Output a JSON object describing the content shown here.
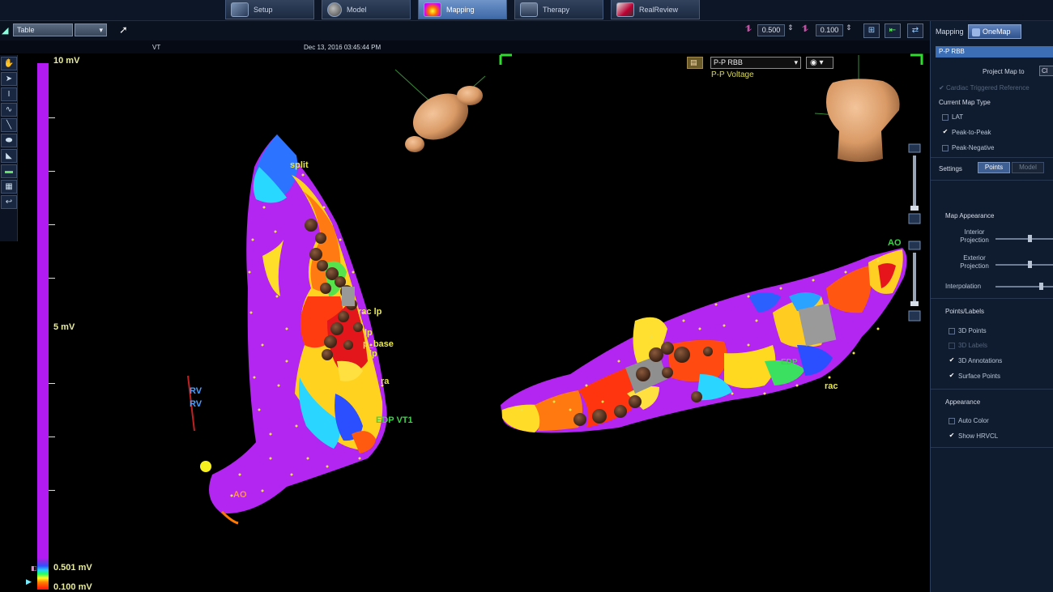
{
  "tabs": [
    {
      "label": "Setup",
      "icon": "setup-icon"
    },
    {
      "label": "Model",
      "icon": "model-icon"
    },
    {
      "label": "Mapping",
      "icon": "mapping-icon",
      "active": true
    },
    {
      "label": "Therapy",
      "icon": "therapy-icon"
    },
    {
      "label": "RealReview",
      "icon": "realreview-icon"
    }
  ],
  "toolbar": {
    "view_dropdown": "Table",
    "value1": "0.500",
    "value2": "0.100"
  },
  "info": {
    "map_name": "VT",
    "timestamp": "Dec 13, 2016 03:45:44 PM"
  },
  "scale": {
    "top": "10 mV",
    "mid": "5 mV",
    "low": "0.501 mV",
    "bottom": "0.100 mV"
  },
  "viewport": {
    "map_select": "P-P RBB",
    "map_type_label": "P-P Voltage"
  },
  "labels": {
    "split": "split",
    "rac_lp": "rac lp",
    "lp": "lp",
    "p_base": "p_base",
    "lp2": "lp",
    "ra": "ra",
    "edp_vt1": "EDP VT1",
    "rv1": "RV",
    "rv2": "RV",
    "ao_left": "AO",
    "ao_right": "AO",
    "edp_right": "EDP",
    "rac_right": "rac"
  },
  "panel": {
    "mapping_label": "Mapping",
    "onemap_label": "OneMap",
    "selected_map": "P-P RBB",
    "project_map_label": "Project Map to",
    "project_map_value": "Cl",
    "cardiac_ref": "Cardiac Triggered Reference",
    "current_map_type": "Current Map Type",
    "map_types": [
      {
        "label": "LAT",
        "checked": false
      },
      {
        "label": "Peak-to-Peak",
        "checked": true
      },
      {
        "label": "Peak-Negative",
        "checked": false
      }
    ],
    "settings_label": "Settings",
    "settings_tabs": [
      "Points",
      "Model"
    ],
    "map_appearance": "Map Appearance",
    "interior_projection": "Interior\nProjection",
    "exterior_projection": "Exterior\nProjection",
    "interpolation": "Interpolation",
    "sliders": {
      "interior": 0.6,
      "exterior": 0.6,
      "interpolation": 0.8
    },
    "points_labels": "Points/Labels",
    "point_options": [
      {
        "label": "3D Points",
        "checked": false
      },
      {
        "label": "3D Labels",
        "checked": false,
        "disabled": true
      },
      {
        "label": "3D Annotations",
        "checked": true
      },
      {
        "label": "Surface Points",
        "checked": true
      }
    ],
    "appearance": "Appearance",
    "appearance_options": [
      {
        "label": "Auto Color",
        "checked": false
      },
      {
        "label": "Show HRVCL",
        "checked": true
      }
    ]
  }
}
